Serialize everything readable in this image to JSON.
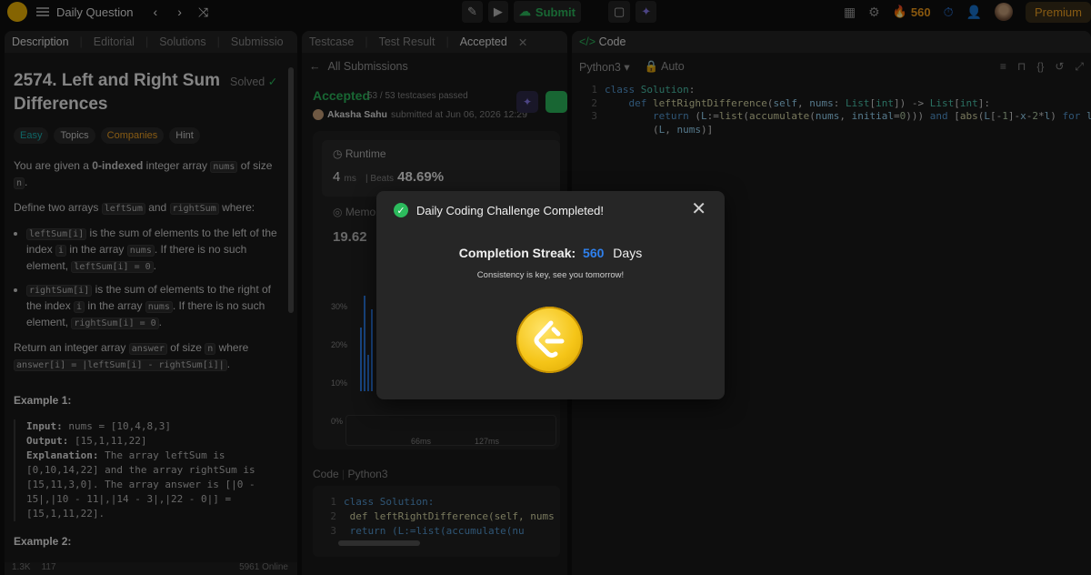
{
  "topbar": {
    "title": "Daily Question",
    "submit_label": "Submit",
    "streak_count": "560",
    "premium_label": "Premium"
  },
  "left": {
    "tabs": [
      "Description",
      "Editorial",
      "Solutions",
      "Submissio"
    ],
    "title": "2574. Left and Right Sum Differences",
    "solved_label": "Solved",
    "chips": [
      "Easy",
      "Topics",
      "Companies",
      "Hint"
    ],
    "desc": {
      "p1a": "You are given a ",
      "p1b": "0-indexed",
      "p1c": " integer array ",
      "p1d": "nums",
      "p1e": " of size ",
      "p1f": "n",
      "p1g": ".",
      "p2a": "Define two arrays ",
      "p2b": "leftSum",
      "p2c": " and ",
      "p2d": "rightSum",
      "p2e": " where:",
      "li1a": "leftSum[i]",
      "li1b": " is the sum of elements to the left of the index ",
      "li1c": "i",
      "li1d": " in the array ",
      "li1e": "nums",
      "li1f": ". If there is no such element, ",
      "li1g": "leftSum[i] = 0",
      "li1h": ".",
      "li2a": "rightSum[i]",
      "li2b": " is the sum of elements to the right of the index ",
      "li2c": "i",
      "li2d": " in the array ",
      "li2e": "nums",
      "li2f": ". If there is no such element, ",
      "li2g": "rightSum[i] = 0",
      "li2h": ".",
      "p3a": "Return an integer array ",
      "p3b": "answer",
      "p3c": " of size ",
      "p3d": "n",
      "p3e": " where ",
      "p3f": "answer[i] = |leftSum[i] - rightSum[i]|",
      "p3g": "."
    },
    "example1_title": "Example 1:",
    "example1": {
      "input_label": "Input:",
      "input": " nums = [10,4,8,3]",
      "output_label": "Output:",
      "output": " [15,1,11,22]",
      "expl_label": "Explanation:",
      "expl": " The array leftSum is [0,10,14,22] and the array rightSum is [15,11,3,0]. The array answer is [|0 - 15|,|10 - 11|,|14 - 3|,|22 - 0|] = [15,1,11,22]."
    },
    "example2_title": "Example 2:",
    "footer": [
      "1.3K",
      "117",
      "5961 Online"
    ]
  },
  "mid": {
    "tabs": [
      "Testcase",
      "Test Result",
      "Accepted"
    ],
    "back_label": "All Submissions",
    "status": "Accepted",
    "passed": "53 / 53 testcases passed",
    "submitter_name": "Akasha Sahu",
    "submitted_at": "submitted at Jun 06, 2026 12:29",
    "runtime_label": "Runtime",
    "runtime_value": "4",
    "runtime_unit": "ms",
    "beats_label": "Beats",
    "beats_value": "48.69%",
    "memory_label": "Memo",
    "memory_value": "19.62",
    "axis": [
      "30%",
      "20%",
      "10%",
      "0%"
    ],
    "mini_x": [
      "66ms",
      "127ms"
    ],
    "code_label": "Code",
    "code_lang": "Python3",
    "code_lines": [
      "class Solution:",
      "    def leftRightDifference(self, nums",
      "        return (L:=list(accumulate(nu"
    ]
  },
  "editor": {
    "title": "Code",
    "lang": "Python3",
    "mode": "Auto",
    "line_numbers": [
      "1",
      "2",
      "3"
    ]
  },
  "modal": {
    "title": "Daily Coding Challenge Completed!",
    "streak_label": "Completion Streak:",
    "streak_value": "560",
    "streak_unit": "Days",
    "subtitle": "Consistency is key, see you tomorrow!"
  },
  "colors": {
    "accent_green": "#2cbb5d",
    "streak_orange": "#f89f1b",
    "streak_blue": "#2f80ed",
    "coin_gold": "#f5c518"
  }
}
